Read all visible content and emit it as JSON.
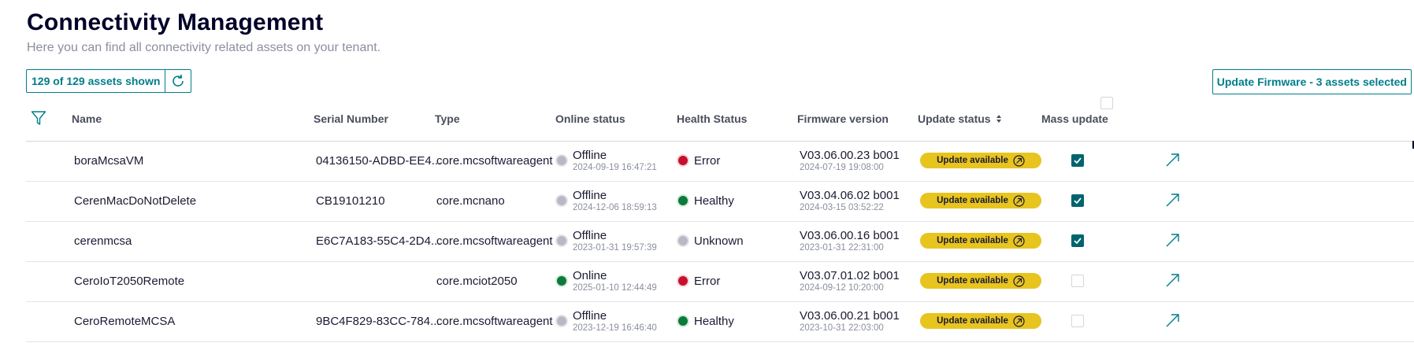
{
  "header": {
    "title": "Connectivity Management",
    "subtitle": "Here you can find all connectivity related assets on your tenant."
  },
  "toolbar": {
    "assets_count": "129 of 129 assets shown",
    "refresh_icon": "refresh-icon",
    "update_firmware_label": "Update Firmware - 3 assets selected"
  },
  "table": {
    "columns": {
      "name": "Name",
      "serial": "Serial Number",
      "type": "Type",
      "online": "Online status",
      "health": "Health Status",
      "firmware": "Firmware version",
      "update": "Update status",
      "mass": "Mass update"
    },
    "update_label": "Update available",
    "rows": [
      {
        "name": "boraMcsaVM",
        "serial": "04136150-ADBD-EE4...",
        "type": "core.mcsoftwareagent",
        "online": "Offline",
        "online_time": "2024-09-19 16:47:21",
        "health": "Error",
        "firmware": "V03.06.00.23 b001",
        "firmware_date": "2024-07-19 19:08:00",
        "mass_checked": true
      },
      {
        "name": "CerenMacDoNotDelete",
        "serial": "CB19101210",
        "type": "core.mcnano",
        "online": "Offline",
        "online_time": "2024-12-06 18:59:13",
        "health": "Healthy",
        "firmware": "V03.04.06.02 b001",
        "firmware_date": "2024-03-15 03:52:22",
        "mass_checked": true
      },
      {
        "name": "cerenmcsa",
        "serial": "E6C7A183-55C4-2D4...",
        "type": "core.mcsoftwareagent",
        "online": "Offline",
        "online_time": "2023-01-31 19:57:39",
        "health": "Unknown",
        "firmware": "V03.06.00.16 b001",
        "firmware_date": "2023-01-31 22:31:00",
        "mass_checked": true
      },
      {
        "name": "CeroIoT2050Remote",
        "serial": "",
        "type": "core.mciot2050",
        "online": "Online",
        "online_time": "2025-01-10 12:44:49",
        "health": "Error",
        "firmware": "V03.07.01.02 b001",
        "firmware_date": "2024-09-12 10:20:00",
        "mass_checked": false
      },
      {
        "name": "CeroRemoteMCSA",
        "serial": "9BC4F829-83CC-784...",
        "type": "core.mcsoftwareagent",
        "online": "Offline",
        "online_time": "2023-12-19 16:46:40",
        "health": "Healthy",
        "firmware": "V03.06.00.21 b001",
        "firmware_date": "2023-10-31 22:03:00",
        "mass_checked": false
      }
    ]
  },
  "colors": {
    "accent": "#007e8a",
    "error": "#c8102e",
    "healthy": "#0b7a3a",
    "unknown": "#b8b9c4",
    "update_pill": "#e8c41e"
  }
}
